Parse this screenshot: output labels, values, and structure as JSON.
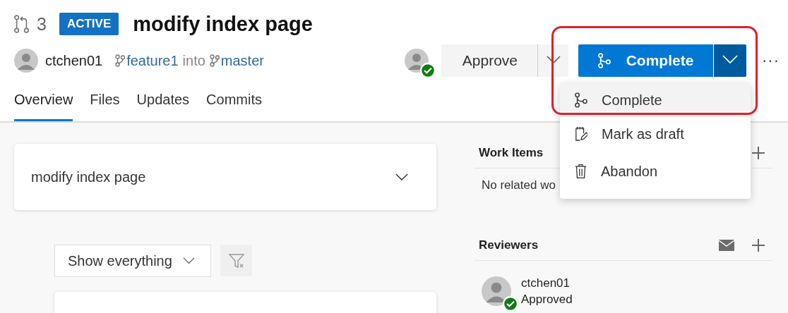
{
  "pull_request": {
    "id": "3",
    "status": "ACTIVE",
    "title": "modify index page",
    "author": "ctchen01",
    "source_branch": "feature1",
    "joiner": "into",
    "target_branch": "master"
  },
  "actions": {
    "my_vote_approved": true,
    "approve": "Approve",
    "complete": "Complete",
    "more": "···",
    "menu_open": true
  },
  "menu": [
    {
      "label": "Complete",
      "kind": "merge",
      "selected": true
    },
    {
      "label": "Mark as draft",
      "kind": "draft",
      "selected": false
    },
    {
      "label": "Abandon",
      "kind": "delete",
      "selected": false
    }
  ],
  "tabs": [
    {
      "label": "Overview",
      "selected": true
    },
    {
      "label": "Files",
      "selected": false
    },
    {
      "label": "Updates",
      "selected": false
    },
    {
      "label": "Commits",
      "selected": false
    }
  ],
  "description": {
    "title": "modify index page"
  },
  "filter": {
    "value": "Show everything"
  },
  "work_items": {
    "title": "Work Items",
    "empty_text": "No related wo"
  },
  "reviewers": {
    "title": "Reviewers",
    "items": [
      {
        "name": "ctchen01",
        "vote": "Approved",
        "approved": true
      }
    ]
  }
}
